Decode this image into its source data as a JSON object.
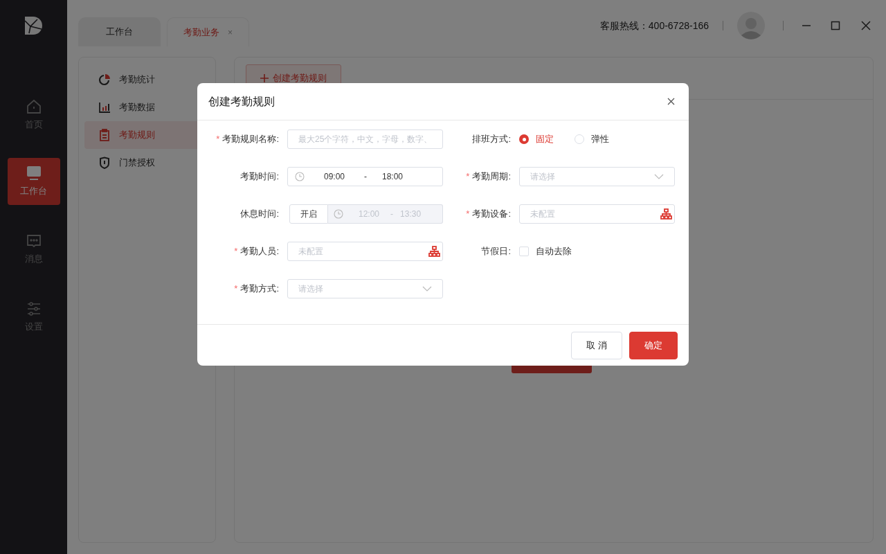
{
  "sidebar": {
    "items": [
      {
        "label": "首页",
        "selected": false
      },
      {
        "label": "工作台",
        "selected": true
      },
      {
        "label": "消息",
        "selected": false
      },
      {
        "label": "设置",
        "selected": false
      }
    ]
  },
  "tabs": [
    {
      "label": "工作台",
      "selected": false,
      "closable": false
    },
    {
      "label": "考勤业务",
      "selected": true,
      "closable": true
    }
  ],
  "tab_close_glyph": "×",
  "header": {
    "hotline": "客服热线：400-6728-166"
  },
  "menu": [
    {
      "label": "考勤统计",
      "selected": false
    },
    {
      "label": "考勤数据",
      "selected": false
    },
    {
      "label": "考勤规则",
      "selected": true
    },
    {
      "label": "门禁授权",
      "selected": false
    }
  ],
  "toolbar": {
    "create_button": "创建考勤规则"
  },
  "dialog": {
    "title": "创建考勤规则",
    "required_mark": "*",
    "fields": [
      {
        "kind": "text",
        "label": "考勤规则名称:",
        "required": true,
        "placeholder": "最大25个字符，中文，字母，数字、"
      },
      {
        "kind": "radio",
        "label": "排班方式:",
        "required": false,
        "options": [
          {
            "label": "固定",
            "selected": true
          },
          {
            "label": "弹性",
            "selected": false
          }
        ]
      },
      {
        "kind": "timerange",
        "label": "考勤时间:",
        "required": false,
        "start": "09:00",
        "separator": "-",
        "end": "18:00"
      },
      {
        "kind": "select",
        "label": "考勤周期:",
        "required": true,
        "placeholder": "请选择"
      },
      {
        "kind": "breaktime",
        "label": "休息时间:",
        "required": false,
        "toggle": "开启",
        "disabled": true,
        "start": "12:00",
        "separator": "-",
        "end": "13:30"
      },
      {
        "kind": "picker",
        "label": "考勤设备:",
        "required": true,
        "placeholder": "未配置"
      },
      {
        "kind": "picker",
        "label": "考勤人员:",
        "required": true,
        "placeholder": "未配置"
      },
      {
        "kind": "checkbox",
        "label": "节假日:",
        "required": false,
        "option": "自动去除",
        "checked": false
      },
      {
        "kind": "select",
        "label": "考勤方式:",
        "required": true,
        "placeholder": "请选择"
      }
    ],
    "buttons": [
      {
        "label": "取 消",
        "kind": "secondary"
      },
      {
        "label": "确定",
        "kind": "primary"
      }
    ]
  }
}
